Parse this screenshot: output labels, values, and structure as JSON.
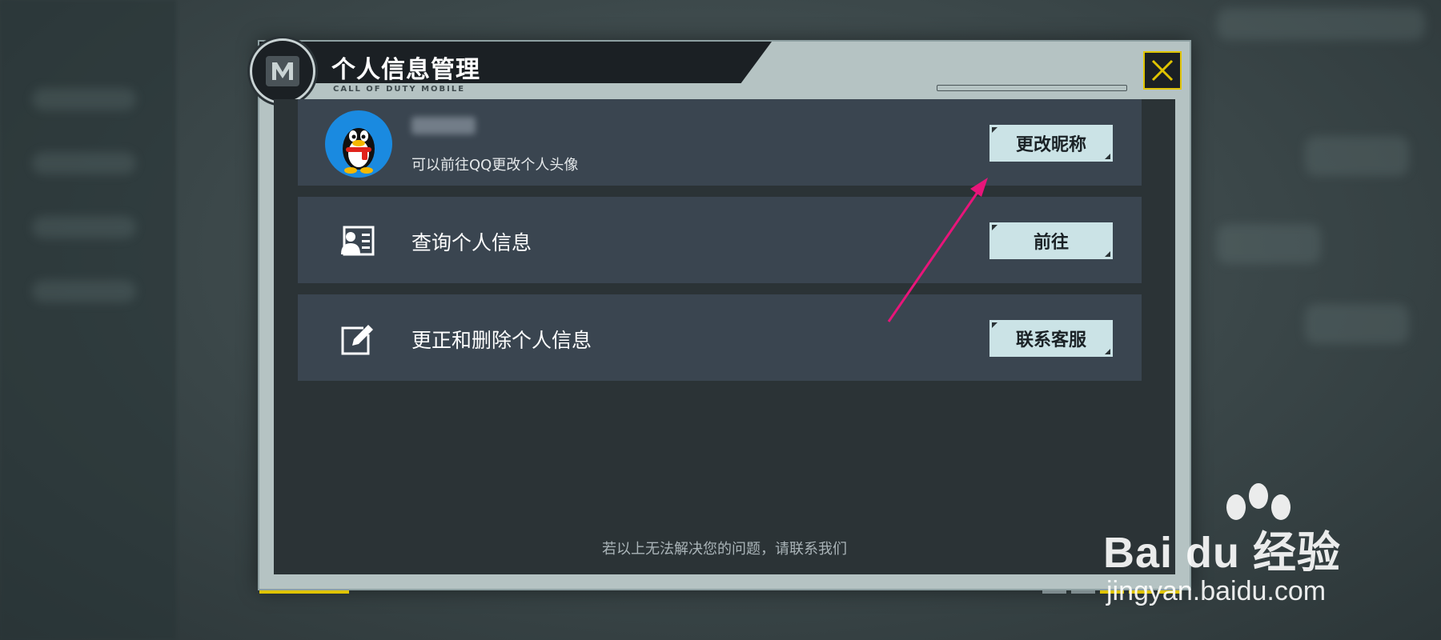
{
  "dialog": {
    "title": "个人信息管理",
    "subtitle": "CALL OF DUTY MOBILE",
    "close_icon": "close-x-icon",
    "accent_color": "#e0c400"
  },
  "profile_row": {
    "avatar_icon": "qq-penguin-avatar",
    "nickname": "",
    "hint": "可以前往QQ更改个人头像",
    "button_label": "更改昵称"
  },
  "rows": [
    {
      "icon": "id-card-icon",
      "label": "查询个人信息",
      "button_label": "前往"
    },
    {
      "icon": "edit-icon",
      "label": "更正和删除个人信息",
      "button_label": "联系客服"
    }
  ],
  "footer": {
    "text": "若以上无法解决您的问题，请联系我们"
  },
  "watermark": {
    "brand": "Bai du 经验",
    "url": "jingyan.baidu.com"
  }
}
